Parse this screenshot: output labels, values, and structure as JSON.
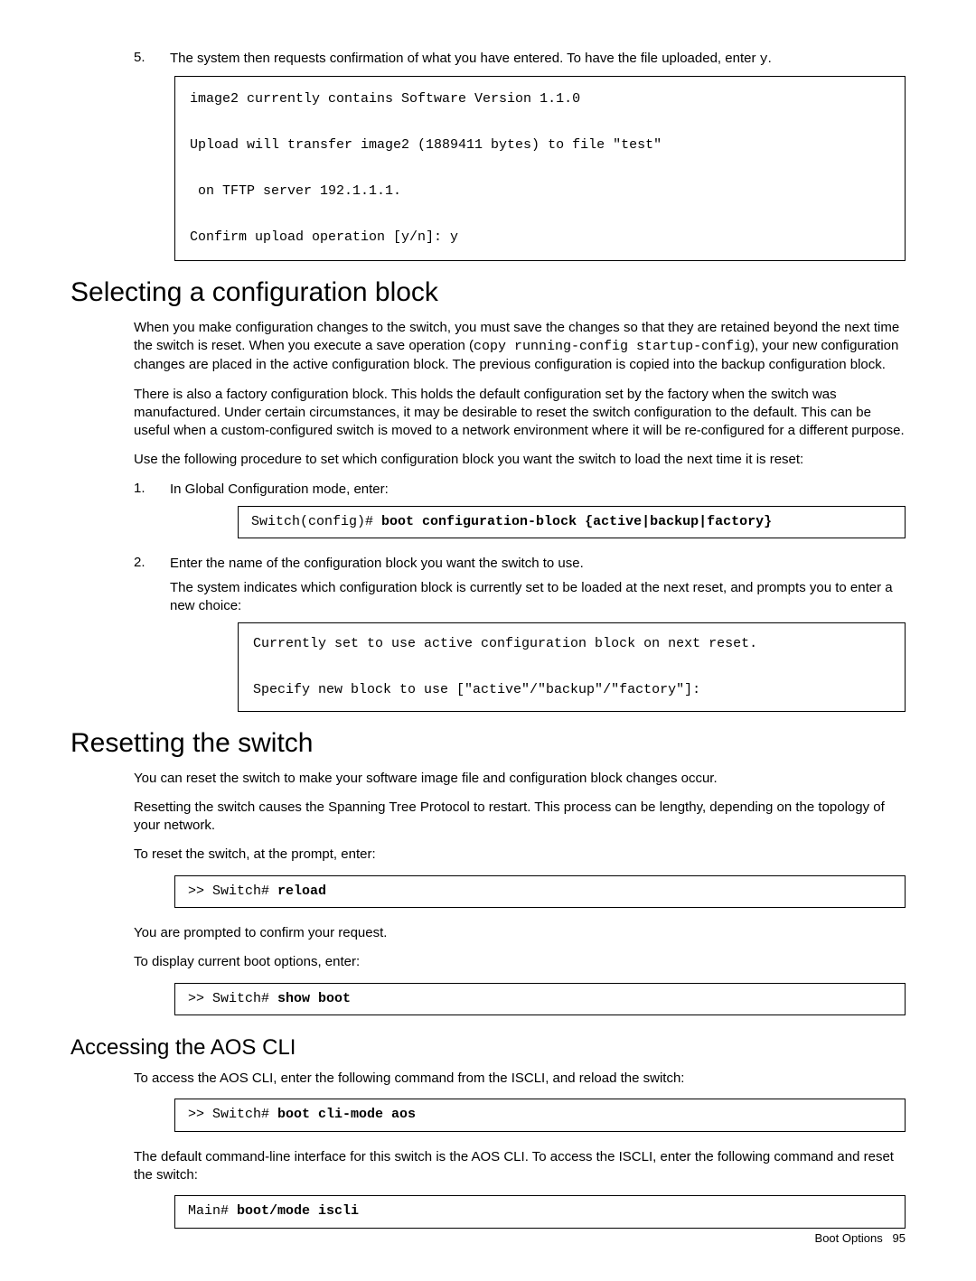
{
  "step5": {
    "num": "5.",
    "text_a": "The system then requests confirmation of what you have entered. To have the file uploaded, enter ",
    "text_b": "y",
    "text_c": ".",
    "code": "image2 currently contains Software Version 1.1.0\n\nUpload will transfer image2 (1889411 bytes) to file \"test\"\n\n on TFTP server 192.1.1.1.\n\nConfirm upload operation [y/n]: y"
  },
  "sec1": {
    "heading": "Selecting a configuration block",
    "p1a": "When you make configuration changes to the switch, you must save the changes so that they are retained beyond the next time the switch is reset. When you execute a save operation (",
    "p1b": "copy running-config startup-config",
    "p1c": "), your new configuration changes are placed in the active configuration block. The previous configuration is copied into the backup configuration block.",
    "p2": "There is also a factory configuration block. This holds the default configuration set by the factory when the switch was manufactured. Under certain circumstances, it may be desirable to reset the switch configuration to the default. This can be useful when a custom-configured switch is moved to a network environment where it will be re-configured for a different purpose.",
    "p3": "Use the following procedure to set which configuration block you want the switch to load the next time it is reset:",
    "step1": {
      "num": "1.",
      "text": "In Global Configuration mode, enter:",
      "code_a": "Switch(config)# ",
      "code_b": "boot configuration-block {active|backup|factory}"
    },
    "step2": {
      "num": "2.",
      "text1": "Enter the name of the configuration block you want the switch to use.",
      "text2": "The system indicates which configuration block is currently set to be loaded at the next reset, and prompts you to enter a new choice:",
      "code": "Currently set to use active configuration block on next reset.\n\nSpecify new block to use [\"active\"/\"backup\"/\"factory\"]:"
    }
  },
  "sec2": {
    "heading": "Resetting the switch",
    "p1": "You can reset the switch to make your software image file and configuration block changes occur.",
    "p2": "Resetting the switch causes the Spanning Tree Protocol to restart. This process can be lengthy, depending on the topology of your network.",
    "p3": "To reset the switch, at the prompt, enter:",
    "code1a": ">> Switch# ",
    "code1b": "reload",
    "p4": "You are prompted to confirm your request.",
    "p5": "To display current boot options, enter:",
    "code2a": ">> Switch# ",
    "code2b": "show boot"
  },
  "sec3": {
    "heading": "Accessing the AOS CLI",
    "p1": "To access the AOS CLI, enter the following command from the ISCLI, and reload the switch:",
    "code1a": ">> Switch# ",
    "code1b": "boot cli-mode aos",
    "p2": "The default command-line interface for this switch is the AOS CLI. To access the ISCLI, enter the following command and reset the switch:",
    "code2a": "Main# ",
    "code2b": "boot/mode iscli"
  },
  "footer": {
    "section": "Boot Options",
    "page": "95"
  }
}
